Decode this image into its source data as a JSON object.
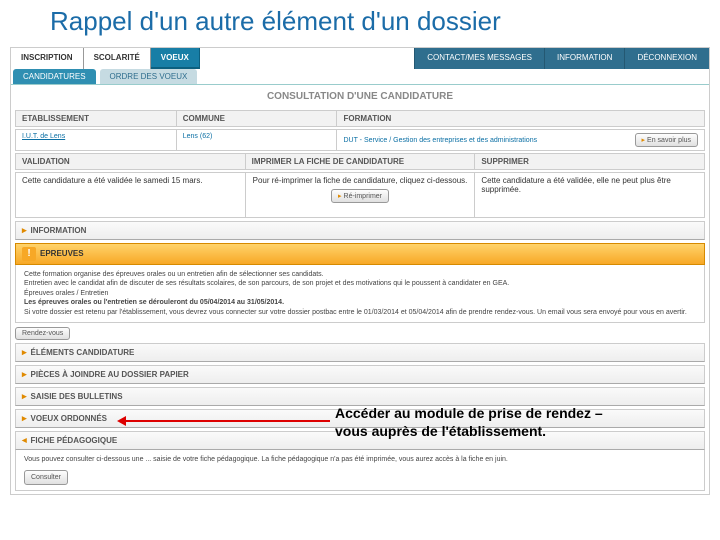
{
  "slide_title": "Rappel d'un autre élément d'un dossier",
  "nav": {
    "left": [
      "INSCRIPTION",
      "SCOLARITÉ",
      "VOEUX"
    ],
    "right": [
      "CONTACT/MES MESSAGES",
      "INFORMATION",
      "DÉCONNEXION"
    ],
    "active_index": 2
  },
  "subtabs": {
    "items": [
      "CANDIDATURES",
      "ORDRE DES VOEUX"
    ],
    "active_index": 0
  },
  "page_title": "CONSULTATION D'UNE CANDIDATURE",
  "cols1": {
    "h0": "ETABLISSEMENT",
    "h1": "COMMUNE",
    "h2": "FORMATION"
  },
  "row1": {
    "etab": "I.U.T. de Lens",
    "commune": "Lens (62)",
    "formation": "DUT - Service / Gestion des entreprises et des administrations",
    "more": "En savoir plus"
  },
  "cols2": {
    "h0": "VALIDATION",
    "h1": "IMPRIMER LA FICHE DE CANDIDATURE",
    "h2": "SUPPRIMER"
  },
  "row2": {
    "validation": "Cette candidature a été validée le samedi 15 mars.",
    "imprimer": "Pour ré-imprimer la fiche de candidature, cliquez ci-dessous.",
    "imprimer_btn": "Ré-imprimer",
    "supprimer": "Cette candidature a été validée, elle ne peut plus être supprimée."
  },
  "acc": {
    "information": "INFORMATION",
    "epreuves": "EPREUVES",
    "epreuves_body_l1": "Cette formation organise des épreuves orales ou un entretien afin de sélectionner ses candidats.",
    "epreuves_body_l2": "Entretien avec le candidat afin de discuter de ses résultats scolaires, de son parcours, de son projet et des motivations qui le poussent à candidater en GEA.",
    "epreuves_body_l3": "Épreuves orales / Entretien",
    "epreuves_body_l4": "Les épreuves orales ou l'entretien se dérouleront du 05/04/2014 au 31/05/2014.",
    "epreuves_body_l5": "Si votre dossier est retenu par l'établissement, vous devrez vous connecter sur votre dossier postbac entre le 01/03/2014 et 05/04/2014 afin de prendre rendez-vous. Un email vous sera envoyé pour vous en avertir.",
    "rv_btn": "Rendez-vous",
    "elements": "ÉLÉMENTS CANDIDATURE",
    "pieces": "PIÈCES À JOINDRE AU DOSSIER PAPIER",
    "bulletins": "SAISIE DES BULLETINS",
    "voeux": "VOEUX ORDONNÉS",
    "fiche": "FICHE PÉDAGOGIQUE",
    "fiche_body": "Vous pouvez consulter ci-dessous une ... saisie de votre fiche pédagogique. La fiche pédagogique n'a pas été imprimée, vous aurez accès à la fiche en juin.",
    "consulter": "Consulter"
  },
  "annotation": "Accéder au module de prise de rendez – vous auprès de l'établissement."
}
